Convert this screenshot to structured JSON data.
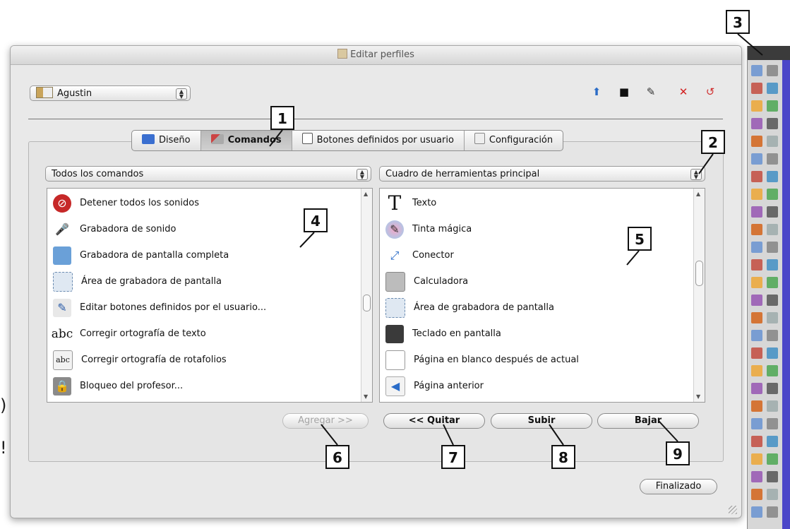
{
  "window": {
    "title": "Editar perfiles"
  },
  "profile": {
    "selected": "Agustin"
  },
  "toolbar_icons": [
    "upload-icon",
    "save-icon",
    "edit-icon",
    "delete-icon",
    "reset-icon"
  ],
  "tabs": [
    {
      "label": "Diseño",
      "icon": "layout-icon"
    },
    {
      "label": "Comandos",
      "icon": "tools-icon",
      "active": true
    },
    {
      "label": "Botones definidos por usuario",
      "icon": "user-button-icon"
    },
    {
      "label": "Configuración",
      "icon": "config-icon"
    }
  ],
  "left_dropdown": {
    "selected": "Todos los comandos"
  },
  "right_dropdown": {
    "selected": "Cuadro de herramientas principal"
  },
  "left_list": [
    {
      "label": "Detener todos los sonidos",
      "icon": "stop-sound-icon"
    },
    {
      "label": "Grabadora de sonido",
      "icon": "microphone-icon"
    },
    {
      "label": "Grabadora de pantalla completa",
      "icon": "screen-recorder-icon"
    },
    {
      "label": "Área de grabadora de pantalla",
      "icon": "screen-area-recorder-icon"
    },
    {
      "label": "Editar botones definidos por el usuario...",
      "icon": "edit-user-buttons-icon"
    },
    {
      "label": "Corregir ortografía de texto",
      "icon": "spellcheck-text-icon"
    },
    {
      "label": "Corregir ortografía de rotafolios",
      "icon": "spellcheck-flipchart-icon"
    },
    {
      "label": "Bloqueo del profesor...",
      "icon": "teacher-lock-icon"
    }
  ],
  "right_list": [
    {
      "label": "Texto",
      "icon": "text-icon"
    },
    {
      "label": "Tinta mágica",
      "icon": "magic-ink-icon"
    },
    {
      "label": "Conector",
      "icon": "connector-icon"
    },
    {
      "label": "Calculadora",
      "icon": "calculator-icon"
    },
    {
      "label": "Área de grabadora de pantalla",
      "icon": "screen-area-recorder-icon"
    },
    {
      "label": "Teclado en pantalla",
      "icon": "keyboard-icon"
    },
    {
      "label": "Página en blanco después de actual",
      "icon": "blank-page-icon"
    },
    {
      "label": "Página anterior",
      "icon": "previous-page-icon"
    }
  ],
  "buttons": {
    "add": "Agregar >>",
    "remove": "<< Quitar",
    "up": "Subir",
    "down": "Bajar",
    "done": "Finalizado"
  },
  "callouts": [
    "1",
    "2",
    "3",
    "4",
    "5",
    "6",
    "7",
    "8",
    "9"
  ],
  "colors": {
    "toolbox_strip": "#4b46c8",
    "delete": "#d22020"
  }
}
